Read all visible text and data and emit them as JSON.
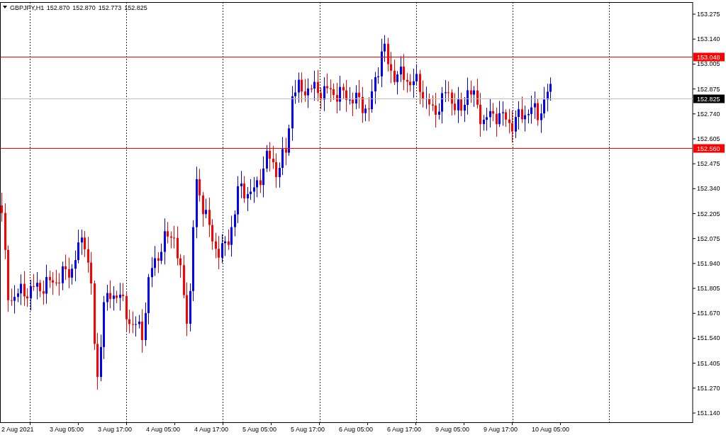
{
  "chart": {
    "symbol": "GBPJPY,H1",
    "quote": [
      "152.870",
      "152.870",
      "152.773",
      "152.825"
    ]
  },
  "price_axis": {
    "labels": [
      "153.275",
      "153.140",
      "153.005",
      "152.875",
      "152.740",
      "152.605",
      "152.475",
      "152.340",
      "152.205",
      "152.075",
      "151.940",
      "151.805",
      "151.670",
      "151.540",
      "151.405",
      "151.270",
      "151.140"
    ]
  },
  "time_axis": {
    "labels": [
      "2 Aug 2021",
      "3 Aug 05:00",
      "3 Aug 17:00",
      "4 Aug 05:00",
      "4 Aug 17:00",
      "5 Aug 05:00",
      "5 Aug 17:00",
      "6 Aug 05:00",
      "6 Aug 17:00",
      "9 Aug 05:00",
      "9 Aug 17:00",
      "10 Aug 05:00"
    ]
  },
  "price_lines": [
    {
      "kind": "level",
      "label": "153.048",
      "color": "#ff0000"
    },
    {
      "kind": "bid",
      "label": "152.825",
      "color": "#000000"
    },
    {
      "kind": "level",
      "label": "152.560",
      "color": "#ff0000"
    }
  ]
}
